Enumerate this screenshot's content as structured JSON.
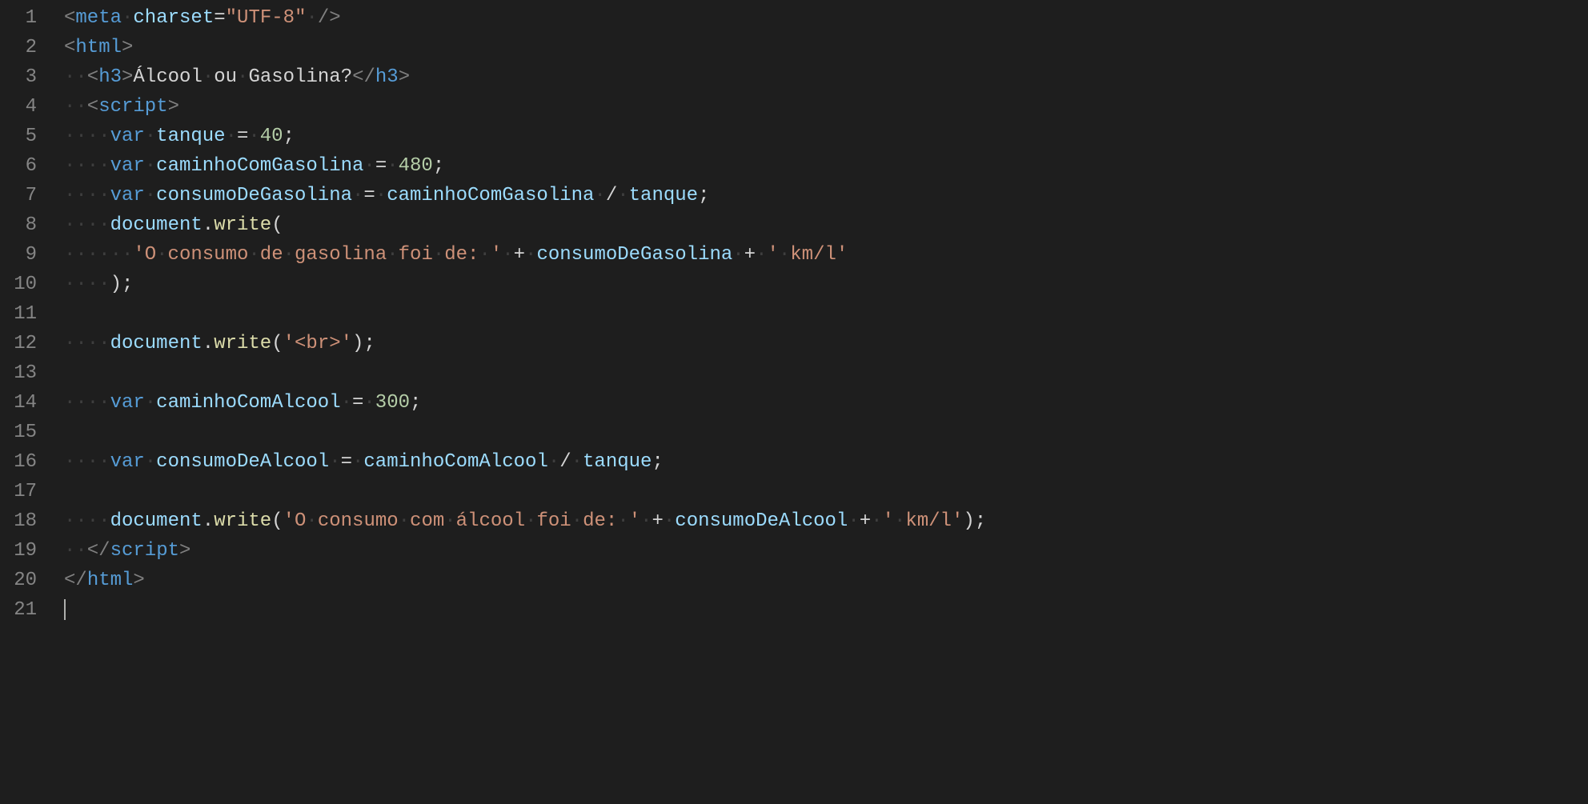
{
  "lineNumbers": [
    "1",
    "2",
    "3",
    "4",
    "5",
    "6",
    "7",
    "8",
    "9",
    "10",
    "11",
    "12",
    "13",
    "14",
    "15",
    "16",
    "17",
    "18",
    "19",
    "20",
    "21"
  ],
  "code": {
    "l1": {
      "indent": 0,
      "tokens": [
        [
          "brk",
          "<"
        ],
        [
          "tag",
          "meta"
        ],
        [
          "text",
          " "
        ],
        [
          "attr",
          "charset"
        ],
        [
          "op",
          "="
        ],
        [
          "str",
          "\"UTF-8\""
        ],
        [
          "text",
          " "
        ],
        [
          "brk",
          "/>"
        ]
      ]
    },
    "l2": {
      "indent": 0,
      "tokens": [
        [
          "brk",
          "<"
        ],
        [
          "tag",
          "html"
        ],
        [
          "brk",
          ">"
        ]
      ]
    },
    "l3": {
      "indent": 2,
      "tokens": [
        [
          "brk",
          "<"
        ],
        [
          "tag",
          "h3"
        ],
        [
          "brk",
          ">"
        ],
        [
          "text",
          "Álcool ou Gasolina?"
        ],
        [
          "brk",
          "</"
        ],
        [
          "tag",
          "h3"
        ],
        [
          "brk",
          ">"
        ]
      ]
    },
    "l4": {
      "indent": 2,
      "tokens": [
        [
          "brk",
          "<"
        ],
        [
          "tag",
          "script"
        ],
        [
          "brk",
          ">"
        ]
      ]
    },
    "l5": {
      "indent": 4,
      "tokens": [
        [
          "kw",
          "var"
        ],
        [
          "text",
          " "
        ],
        [
          "var",
          "tanque"
        ],
        [
          "text",
          " "
        ],
        [
          "op",
          "="
        ],
        [
          "text",
          " "
        ],
        [
          "num",
          "40"
        ],
        [
          "punc",
          ";"
        ]
      ]
    },
    "l6": {
      "indent": 4,
      "tokens": [
        [
          "kw",
          "var"
        ],
        [
          "text",
          " "
        ],
        [
          "var",
          "caminhoComGasolina"
        ],
        [
          "text",
          " "
        ],
        [
          "op",
          "="
        ],
        [
          "text",
          " "
        ],
        [
          "num",
          "480"
        ],
        [
          "punc",
          ";"
        ]
      ]
    },
    "l7": {
      "indent": 4,
      "tokens": [
        [
          "kw",
          "var"
        ],
        [
          "text",
          " "
        ],
        [
          "var",
          "consumoDeGasolina"
        ],
        [
          "text",
          " "
        ],
        [
          "op",
          "="
        ],
        [
          "text",
          " "
        ],
        [
          "var",
          "caminhoComGasolina"
        ],
        [
          "text",
          " "
        ],
        [
          "op",
          "/"
        ],
        [
          "text",
          " "
        ],
        [
          "var",
          "tanque"
        ],
        [
          "punc",
          ";"
        ]
      ]
    },
    "l8": {
      "indent": 4,
      "tokens": [
        [
          "obj",
          "document"
        ],
        [
          "punc",
          "."
        ],
        [
          "func",
          "write"
        ],
        [
          "punc",
          "("
        ]
      ]
    },
    "l9": {
      "indent": 6,
      "tokens": [
        [
          "lit",
          "'O consumo de gasolina foi de: '"
        ],
        [
          "text",
          " "
        ],
        [
          "op",
          "+"
        ],
        [
          "text",
          " "
        ],
        [
          "var",
          "consumoDeGasolina"
        ],
        [
          "text",
          " "
        ],
        [
          "op",
          "+"
        ],
        [
          "text",
          " "
        ],
        [
          "lit",
          "' km/l'"
        ]
      ]
    },
    "l10": {
      "indent": 4,
      "tokens": [
        [
          "punc",
          ")"
        ],
        [
          "punc",
          ";"
        ]
      ]
    },
    "l11": {
      "indent": 0,
      "tokens": []
    },
    "l12": {
      "indent": 4,
      "tokens": [
        [
          "obj",
          "document"
        ],
        [
          "punc",
          "."
        ],
        [
          "func",
          "write"
        ],
        [
          "punc",
          "("
        ],
        [
          "lit",
          "'<br>'"
        ],
        [
          "punc",
          ")"
        ],
        [
          "punc",
          ";"
        ]
      ]
    },
    "l13": {
      "indent": 0,
      "tokens": []
    },
    "l14": {
      "indent": 4,
      "tokens": [
        [
          "kw",
          "var"
        ],
        [
          "text",
          " "
        ],
        [
          "var",
          "caminhoComAlcool"
        ],
        [
          "text",
          " "
        ],
        [
          "op",
          "="
        ],
        [
          "text",
          " "
        ],
        [
          "num",
          "300"
        ],
        [
          "punc",
          ";"
        ]
      ]
    },
    "l15": {
      "indent": 0,
      "tokens": []
    },
    "l16": {
      "indent": 4,
      "tokens": [
        [
          "kw",
          "var"
        ],
        [
          "text",
          " "
        ],
        [
          "var",
          "consumoDeAlcool"
        ],
        [
          "text",
          " "
        ],
        [
          "op",
          "="
        ],
        [
          "text",
          " "
        ],
        [
          "var",
          "caminhoComAlcool"
        ],
        [
          "text",
          " "
        ],
        [
          "op",
          "/"
        ],
        [
          "text",
          " "
        ],
        [
          "var",
          "tanque"
        ],
        [
          "punc",
          ";"
        ]
      ]
    },
    "l17": {
      "indent": 0,
      "tokens": []
    },
    "l18": {
      "indent": 4,
      "tokens": [
        [
          "obj",
          "document"
        ],
        [
          "punc",
          "."
        ],
        [
          "func",
          "write"
        ],
        [
          "punc",
          "("
        ],
        [
          "lit",
          "'O consumo com álcool foi de: '"
        ],
        [
          "text",
          " "
        ],
        [
          "op",
          "+"
        ],
        [
          "text",
          " "
        ],
        [
          "var",
          "consumoDeAlcool"
        ],
        [
          "text",
          " "
        ],
        [
          "op",
          "+"
        ],
        [
          "text",
          " "
        ],
        [
          "lit",
          "' km/l'"
        ],
        [
          "punc",
          ")"
        ],
        [
          "punc",
          ";"
        ]
      ]
    },
    "l19": {
      "indent": 2,
      "tokens": [
        [
          "brk",
          "</"
        ],
        [
          "tag",
          "script"
        ],
        [
          "brk",
          ">"
        ]
      ]
    },
    "l20": {
      "indent": 0,
      "tokens": [
        [
          "brk",
          "</"
        ],
        [
          "tag",
          "html"
        ],
        [
          "brk",
          ">"
        ]
      ]
    },
    "l21": {
      "indent": 0,
      "tokens": [],
      "cursor": true
    }
  },
  "whitespaceDot": "·",
  "tokenClassMap": {
    "brk": "t-brk",
    "tag": "t-tag",
    "attr": "t-attr",
    "str": "t-str",
    "text": "t-text",
    "kw": "t-kw",
    "var": "t-var",
    "op": "t-op",
    "num": "t-num",
    "punc": "t-punc",
    "obj": "t-obj",
    "func": "t-func",
    "lit": "t-lit"
  }
}
